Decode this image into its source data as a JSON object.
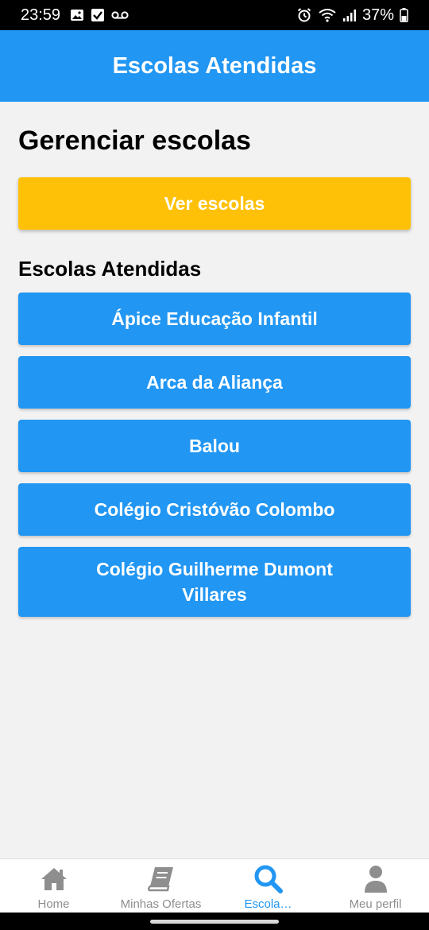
{
  "status_bar": {
    "time": "23:59",
    "battery": "37%",
    "icons": [
      "image-icon",
      "checkbox-icon",
      "voicemail-icon",
      "alarm-icon",
      "wifi-icon",
      "signal-icon",
      "battery-icon"
    ]
  },
  "header": {
    "title": "Escolas Atendidas"
  },
  "main": {
    "page_title": "Gerenciar escolas",
    "ver_escolas_label": "Ver escolas",
    "section_title": "Escolas Atendidas",
    "schools": [
      "Ápice Educação Infantil",
      "Arca da Aliança",
      "Balou",
      "Colégio Cristóvão Colombo",
      "Colégio Guilherme Dumont Villares"
    ]
  },
  "bottom_nav": {
    "items": [
      {
        "label": "Home",
        "icon": "home-icon",
        "active": false
      },
      {
        "label": "Minhas Ofertas",
        "icon": "book-icon",
        "active": false
      },
      {
        "label": "Escola…",
        "icon": "search-icon",
        "active": true
      },
      {
        "label": "Meu perfil",
        "icon": "user-icon",
        "active": false
      }
    ]
  },
  "colors": {
    "primary": "#2196F3",
    "accent": "#FFC107",
    "background": "#f2f2f2",
    "nav_inactive": "#8e8e8e"
  }
}
